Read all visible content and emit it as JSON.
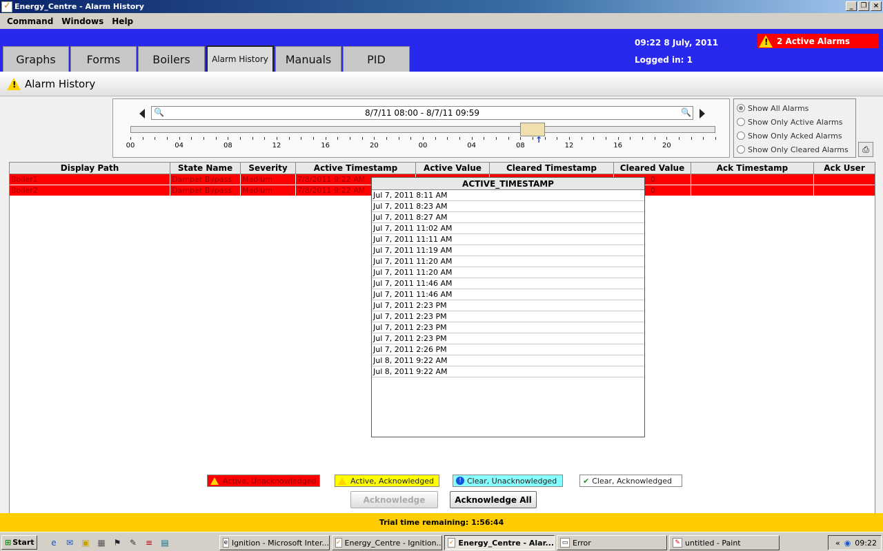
{
  "window": {
    "title": "Energy_Centre - Alarm History",
    "minimize": "_",
    "restore": "❐",
    "close": "×"
  },
  "menu": {
    "command": "Command",
    "windows": "Windows",
    "help": "Help"
  },
  "header": {
    "datetime": "09:22 8 July, 2011",
    "logged_in": "Logged in: 1",
    "active_alarms": "2 Active Alarms",
    "tabs": [
      "Graphs",
      "Forms",
      "Boilers",
      "Alarm History",
      "Manuals",
      "PID"
    ],
    "active_tab": "Alarm History"
  },
  "page": {
    "title": "Alarm History"
  },
  "timeline": {
    "range": "8/7/11 08:00 - 8/7/11 09:59",
    "labels": [
      "00",
      "04",
      "08",
      "12",
      "16",
      "20",
      "00",
      "04",
      "08",
      "12",
      "16",
      "20"
    ]
  },
  "filters": {
    "options": [
      "Show All Alarms",
      "Show Only Active Alarms",
      "Show Only Acked Alarms",
      "Show Only Cleared Alarms"
    ],
    "selected": 0
  },
  "table": {
    "columns": [
      "Display Path",
      "State Name",
      "Severity",
      "Active Timestamp",
      "Active Value",
      "Cleared Timestamp",
      "Cleared Value",
      "Ack Timestamp",
      "Ack User"
    ],
    "rows": [
      [
        "Boiler1",
        "Damper Bypass",
        "Medium",
        "7/8/2011 9:22 AM",
        "",
        "",
        "0",
        "",
        ""
      ],
      [
        "Boiler2",
        "Damper Bypass",
        "Medium",
        "7/8/2011 9:22 AM",
        "",
        "",
        "0",
        "",
        ""
      ]
    ]
  },
  "popup": {
    "header": "ACTIVE_TIMESTAMP",
    "values": [
      "Jul 7, 2011 8:11 AM",
      "Jul 7, 2011 8:23 AM",
      "Jul 7, 2011 8:27 AM",
      "Jul 7, 2011 11:02 AM",
      "Jul 7, 2011 11:11 AM",
      "Jul 7, 2011 11:19 AM",
      "Jul 7, 2011 11:20 AM",
      "Jul 7, 2011 11:20 AM",
      "Jul 7, 2011 11:46 AM",
      "Jul 7, 2011 11:46 AM",
      "Jul 7, 2011 2:23 PM",
      "Jul 7, 2011 2:23 PM",
      "Jul 7, 2011 2:23 PM",
      "Jul 7, 2011 2:23 PM",
      "Jul 7, 2011 2:26 PM",
      "Jul 8, 2011 9:22 AM",
      "Jul 8, 2011 9:22 AM"
    ]
  },
  "legend": {
    "active_unack": "Active, Unacknowledged",
    "active_ack": "Active, Acknowledged",
    "clear_unack": "Clear, Unacknowledged",
    "clear_ack": "Clear, Acknowledged"
  },
  "buttons": {
    "acknowledge": "Acknowledge",
    "acknowledge_all": "Acknowledge All"
  },
  "trial": "Trial time remaining: 1:56:44",
  "taskbar": {
    "start": "Start",
    "tasks": [
      "Ignition - Microsoft Inter...",
      "Energy_Centre - Ignition...",
      "Energy_Centre - Alar...",
      "Error",
      "untitled - Paint"
    ],
    "active_task": 2,
    "tray_expand": "«",
    "clock": "09:22"
  },
  "colors": {
    "header_blue": "#2929ee",
    "alarm_red": "#ff0000",
    "trial_yellow": "#ffcc00"
  }
}
